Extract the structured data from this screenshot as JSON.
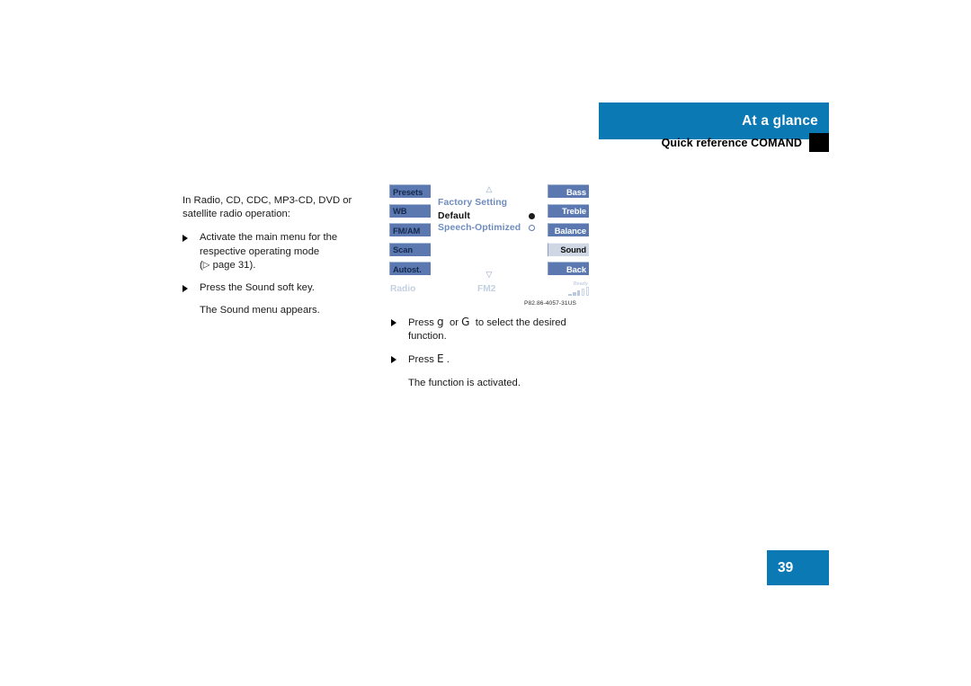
{
  "header": {
    "title": "At a glance",
    "subtitle": "Quick reference COMAND"
  },
  "left_column": {
    "intro": "In Radio, CD, CDC, MP3-CD, DVD or satellite radio operation:",
    "bullets": [
      "Activate the main menu for the respective operating mode",
      "Press the Sound soft key."
    ],
    "page_reference": "page 31",
    "page_reference_prefix": "(",
    "page_reference_arrow": "▷",
    "page_reference_suffix": ").",
    "result_note": "The Sound menu appears."
  },
  "comand_screen": {
    "left_soft_keys": [
      {
        "label": "Presets",
        "selected": false
      },
      {
        "label": "WB",
        "selected": false
      },
      {
        "label": "FM/AM",
        "selected": false
      },
      {
        "label": "Scan",
        "selected": false
      },
      {
        "label": "Autost.",
        "selected": false
      }
    ],
    "right_soft_keys": [
      {
        "label": "Bass",
        "selected": false
      },
      {
        "label": "Treble",
        "selected": false
      },
      {
        "label": "Balance",
        "selected": false
      },
      {
        "label": "Sound",
        "selected": true
      },
      {
        "label": "Back",
        "selected": false
      }
    ],
    "menu_title": "Factory Setting",
    "menu_options": [
      {
        "label": "Default",
        "selected": true
      },
      {
        "label": "Speech-Optimized",
        "selected": false
      }
    ],
    "scroll_up": "△",
    "scroll_down": "▽",
    "status": {
      "source": "Radio",
      "band": "FM2",
      "ready": "Ready"
    }
  },
  "figure_caption": "P82.86-4057-31US",
  "right_column": {
    "bullet_one_prefix": "Press",
    "bullet_one_glyph_a": "g",
    "bullet_one_middle": "or",
    "bullet_one_glyph_b": "G",
    "bullet_one_suffix": "to select the desired function.",
    "bullet_two_prefix": "Press",
    "bullet_two_glyph": "E",
    "bullet_two_suffix": ".",
    "result_note": "The function is activated."
  },
  "page_number": "39",
  "colors": {
    "brand_blue": "#0b79b3",
    "soft_key_blue": "#5b79b0",
    "menu_blue": "#6f8cbe",
    "status_grey": "#c3d0e2"
  }
}
